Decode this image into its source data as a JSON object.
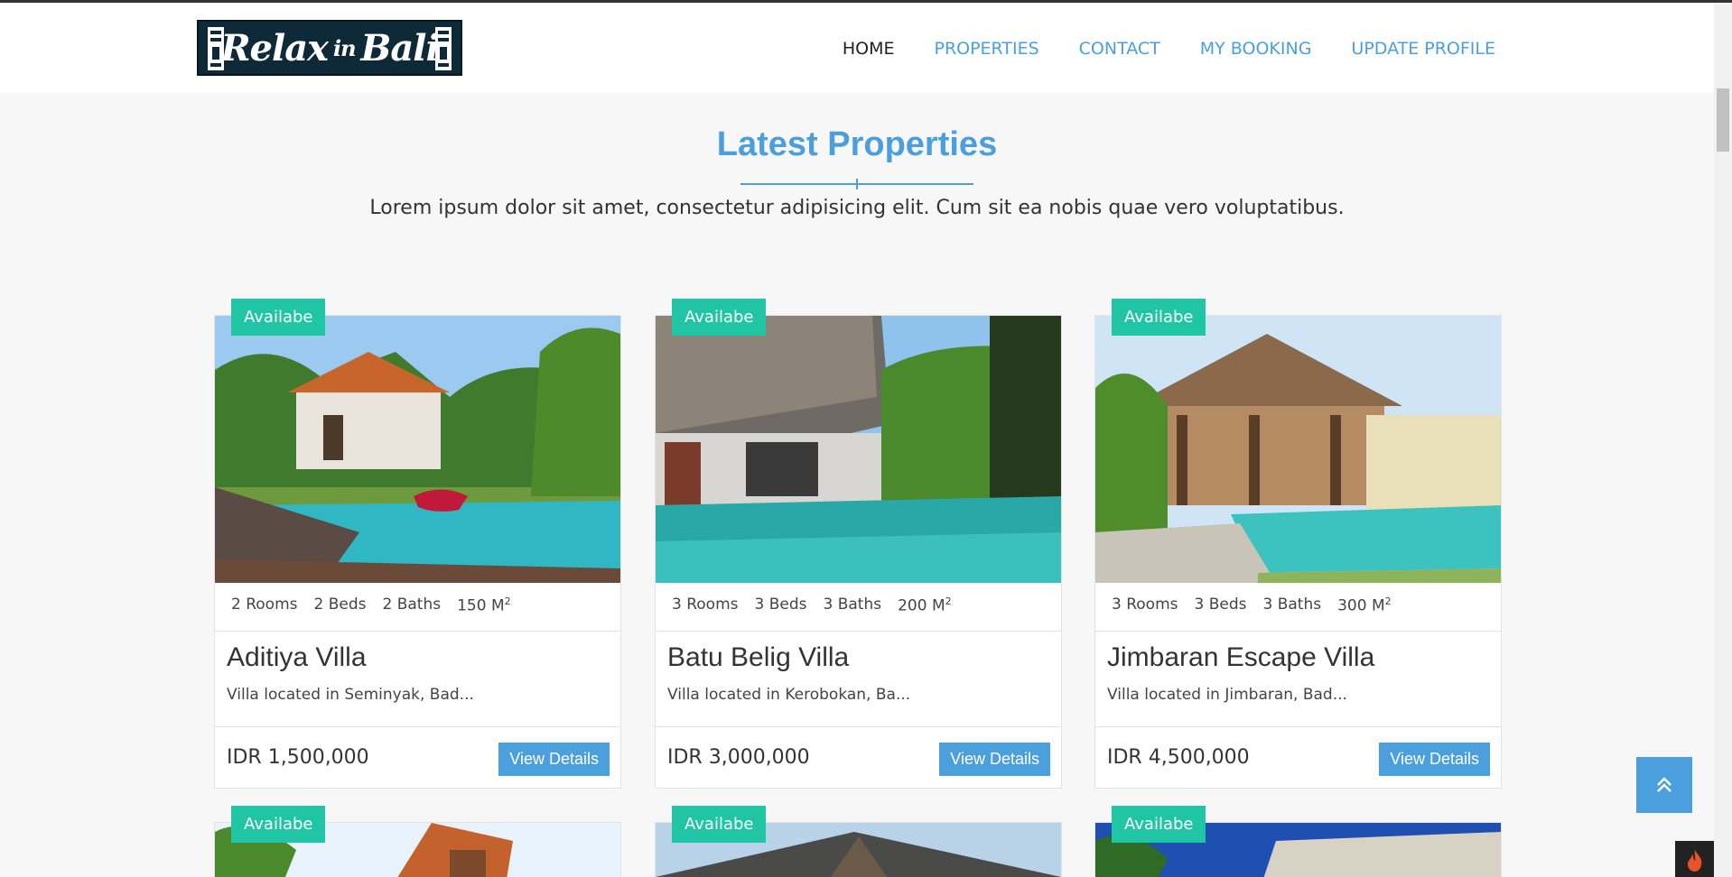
{
  "nav": {
    "items": [
      {
        "label": "HOME",
        "active": true
      },
      {
        "label": "PROPERTIES",
        "active": false
      },
      {
        "label": "CONTACT",
        "active": false
      },
      {
        "label": "MY BOOKING",
        "active": false
      },
      {
        "label": "UPDATE PROFILE",
        "active": false
      }
    ]
  },
  "logo": {
    "text_main": "Relax",
    "text_small": "in",
    "text_end": "Bali"
  },
  "section": {
    "title": "Latest Properties",
    "subtitle": "Lorem ipsum dolor sit amet, consectetur adipisicing elit. Cum sit ea nobis quae vero voluptatibus."
  },
  "properties": [
    {
      "badge": "Availabe",
      "rooms": "2 Rooms",
      "beds": "2 Beds",
      "baths": "2 Baths",
      "area": "150 M",
      "name": "Aditiya Villa",
      "desc": "Villa located in Seminyak, Bad...",
      "price": "IDR 1,500,000",
      "button": "View Details"
    },
    {
      "badge": "Availabe",
      "rooms": "3 Rooms",
      "beds": "3 Beds",
      "baths": "3 Baths",
      "area": "200 M",
      "name": "Batu Belig Villa",
      "desc": "Villa located in Kerobokan, Ba...",
      "price": "IDR 3,000,000",
      "button": "View Details"
    },
    {
      "badge": "Availabe",
      "rooms": "3 Rooms",
      "beds": "3 Beds",
      "baths": "3 Baths",
      "area": "300 M",
      "name": "Jimbaran Escape Villa",
      "desc": "Villa located in Jimbaran, Bad...",
      "price": "IDR 4,500,000",
      "button": "View Details"
    }
  ],
  "partial_properties": [
    {
      "badge": "Availabe"
    },
    {
      "badge": "Availabe"
    },
    {
      "badge": "Availabe"
    }
  ],
  "area_sup": "2",
  "colors": {
    "accent": "#4a9fdc",
    "badge": "#20c5a5"
  }
}
